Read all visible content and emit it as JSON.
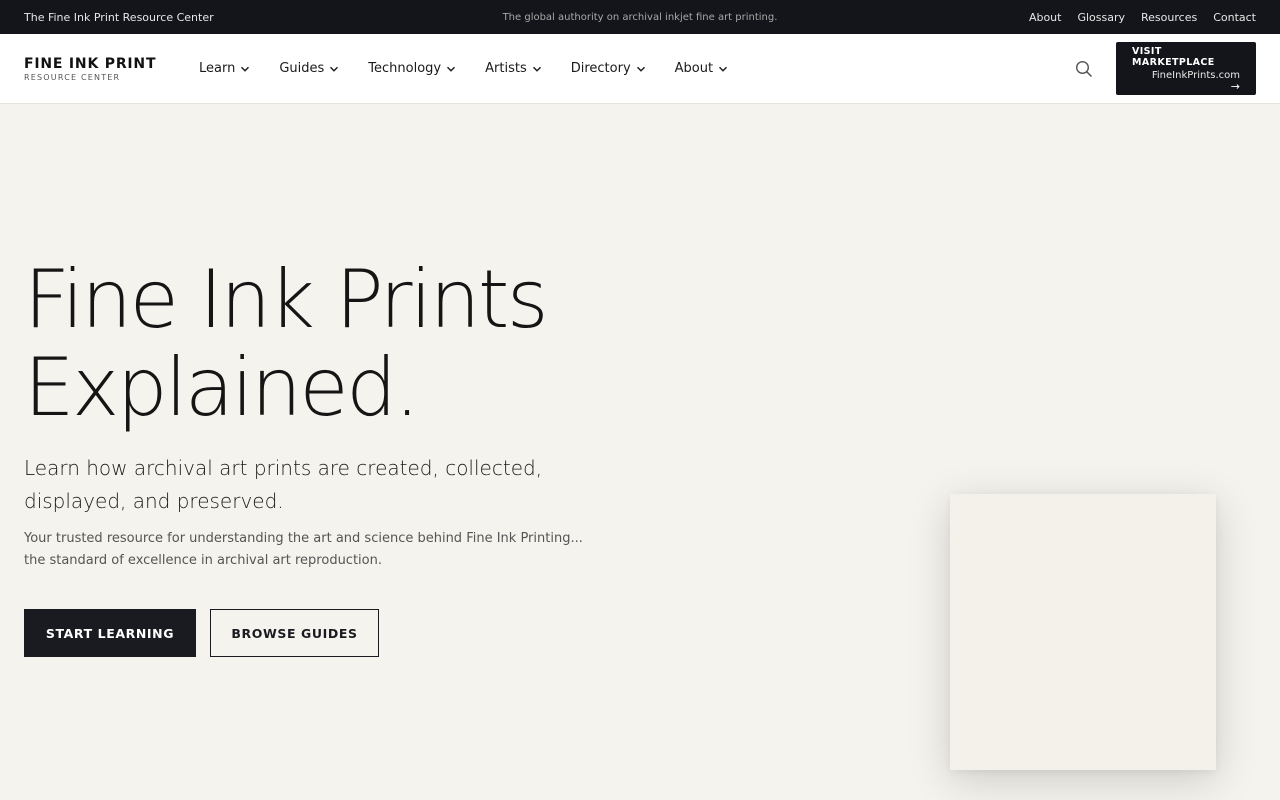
{
  "topbar": {
    "left_text": "The Fine Ink Print Resource Center",
    "tagline": "The global authority on archival inkjet fine art printing.",
    "links": [
      "About",
      "Glossary",
      "Resources",
      "Contact"
    ]
  },
  "header": {
    "logo_main": "FINE INK PRINT",
    "logo_sub": "RESOURCE CENTER",
    "nav": [
      "Learn",
      "Guides",
      "Technology",
      "Artists",
      "Directory",
      "About"
    ],
    "marketplace": {
      "title": "VISIT MARKETPLACE",
      "subtitle": "FineInkPrints.com",
      "arrow": "→"
    }
  },
  "hero": {
    "title_line1": "Fine Ink Prints",
    "title_line2": "Explained.",
    "subtitle": "Learn how archival art prints are created, collected, displayed, and preserved.",
    "description": "Your trusted resource for understanding the art and science behind Fine Ink Printing... the standard of excellence in archival art reproduction.",
    "primary_button": "START LEARNING",
    "secondary_button": "BROWSE GUIDES"
  },
  "icons": {
    "search": "search-icon",
    "chevron": "chevron-down-icon"
  },
  "colors": {
    "dark": "#14151a",
    "background": "#f5f3ed",
    "white": "#ffffff"
  }
}
